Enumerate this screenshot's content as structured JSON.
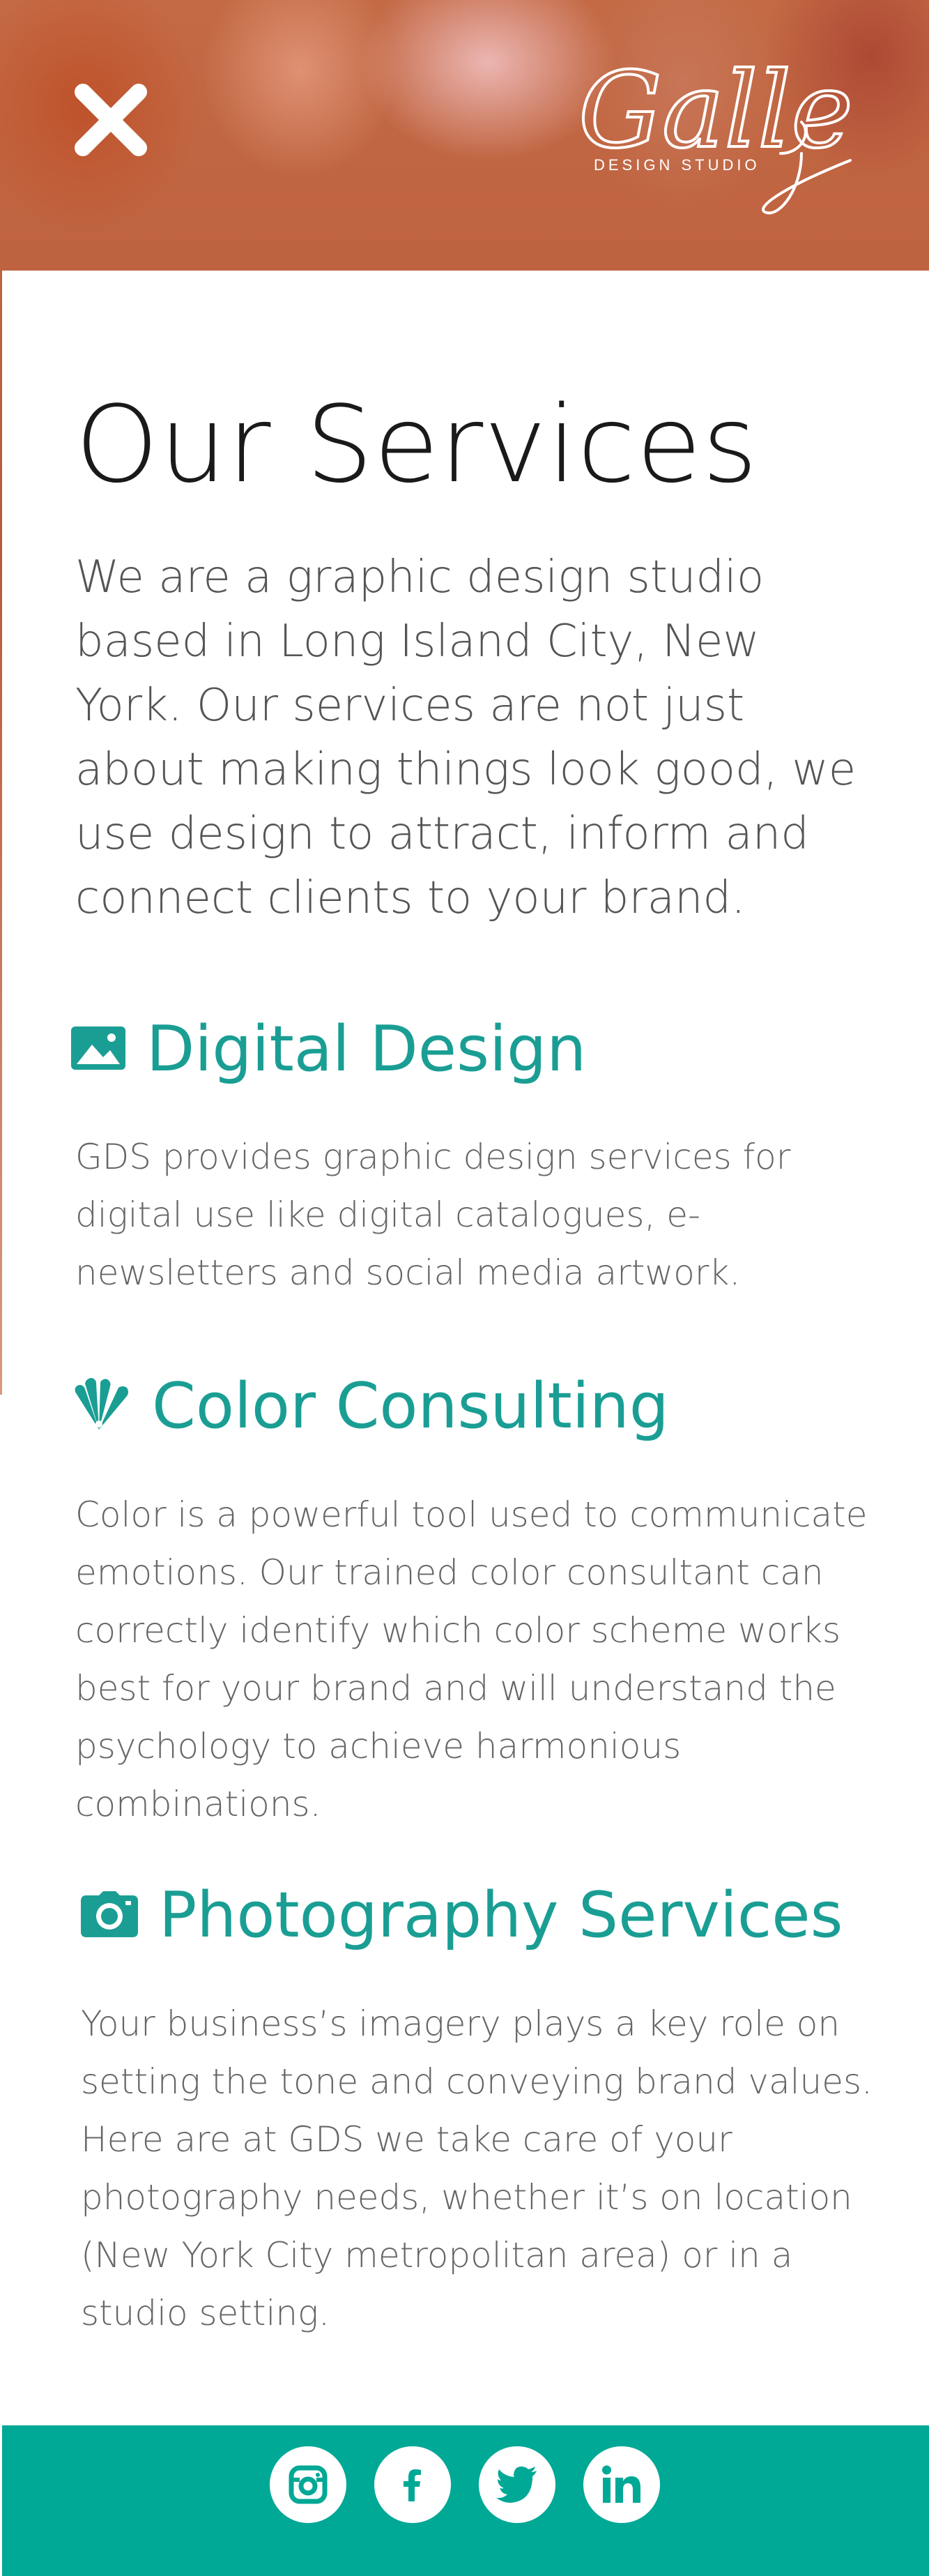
{
  "header": {
    "close_icon": "close-icon",
    "logo": {
      "script_text": "Gallery",
      "subtitle": "DESIGN STUDIO"
    }
  },
  "page": {
    "title": "Our Services",
    "intro": "We are a graphic design studio based in Long Island City, New York. Our services are not just about making things look good, we use design to attract, inform and connect clients to your brand."
  },
  "services": [
    {
      "icon": "image-icon",
      "title": "Digital Design",
      "description": "GDS provides graphic design services for digital use like digital catalogues, e-newsletters and social media artwork."
    },
    {
      "icon": "palette-swatch-icon",
      "title": "Color Consulting",
      "description": "Color is a powerful tool used to communicate emotions. Our trained color consultant can correctly identify which color scheme works best for your brand and will understand the psychology to achieve harmonious combinations."
    },
    {
      "icon": "camera-icon",
      "title": "Photography Services",
      "description": "Your business’s imagery plays a key role on setting the tone and conveying brand values. Here are at GDS we take care of your photography needs, whether it’s on location (New York City metropolitan area) or in a studio setting."
    }
  ],
  "footer": {
    "social_icons": [
      "instagram-icon",
      "facebook-icon",
      "twitter-icon",
      "linkedin-icon"
    ]
  },
  "colors": {
    "accent": "#1a9e94",
    "footer_bg": "#00a896",
    "body_text": "#666666",
    "heading_text": "#1a1a1a"
  }
}
